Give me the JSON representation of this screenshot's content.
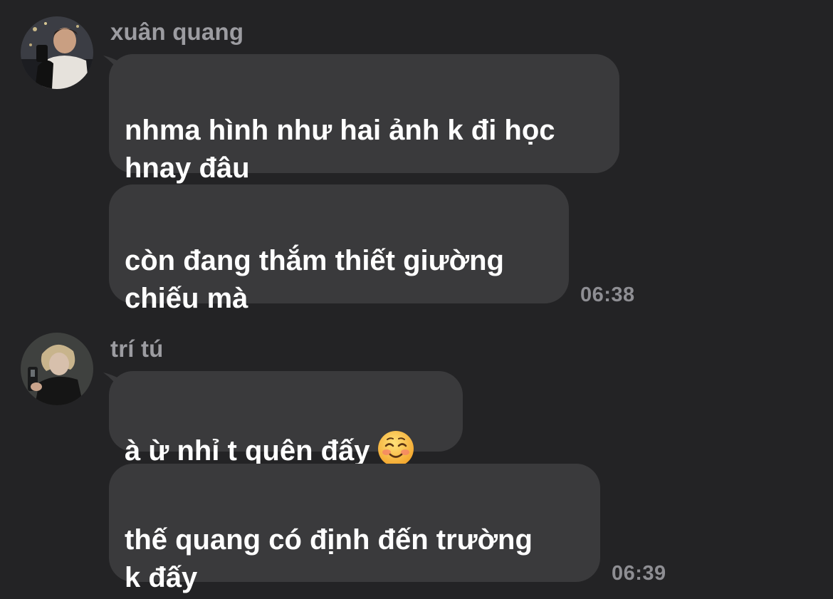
{
  "groups": [
    {
      "sender": "xuân quang",
      "avatar_icon": "person-photo-avatar",
      "messages": [
        {
          "text": "nhma hình như hai ảnh k đi học\nhnay đâu"
        },
        {
          "text": "còn đang thắm thiết giường\nchiếu mà",
          "time": "06:38"
        }
      ]
    },
    {
      "sender": "trí tú",
      "avatar_icon": "person-photo-avatar",
      "messages": [
        {
          "text": "à ừ nhỉ t quên đấy",
          "emoji": "smiling-face-emoji"
        },
        {
          "text": "thế quang có định đến trường\nk đấy",
          "time": "06:39"
        }
      ]
    }
  ],
  "colors": {
    "background": "#232325",
    "bubble": "#3a3a3c",
    "text": "#ffffff",
    "muted": "#9c9ca1"
  }
}
